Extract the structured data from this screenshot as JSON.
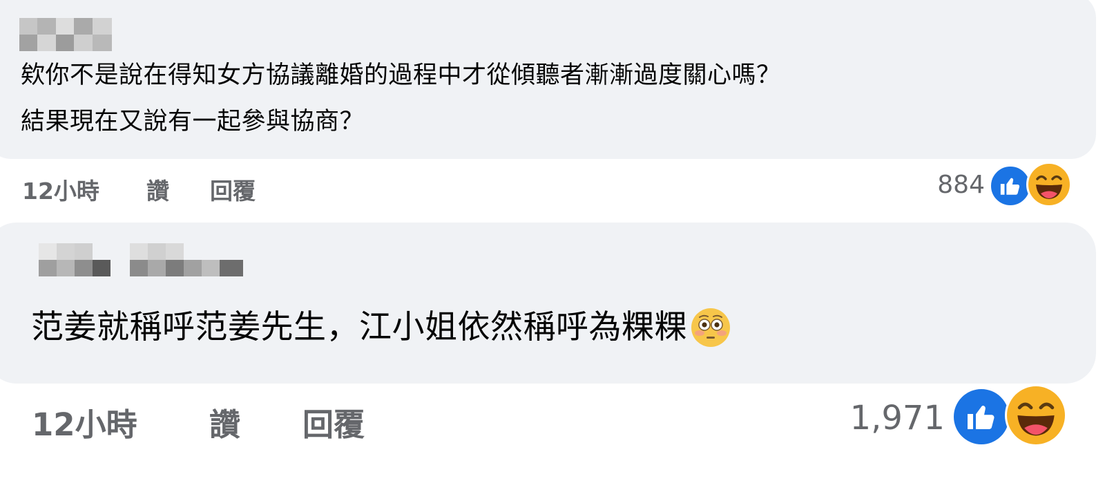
{
  "comments": [
    {
      "text_lines": [
        "欸你不是說在得知女方協議離婚的過程中才從傾聽者漸漸過度關心嗎？",
        "結果現在又說有一起參與協商？"
      ],
      "time": "12小時",
      "like_label": "讚",
      "reply_label": "回覆",
      "reaction_count": "884",
      "reactions": [
        "like-icon",
        "haha-icon"
      ]
    },
    {
      "text": "范姜就稱呼范姜先生，江小姐依然稱呼為粿粿",
      "inline_emoji": "flushed-emoji-icon",
      "time": "12小時",
      "like_label": "讚",
      "reply_label": "回覆",
      "reaction_count": "1,971",
      "reactions": [
        "like-icon",
        "haha-icon"
      ]
    }
  ],
  "colors": {
    "bubble_bg": "#f0f2f5",
    "meta_text": "#65676b",
    "like_blue": "#1b74e4",
    "haha_yellow": "#f7b125"
  }
}
